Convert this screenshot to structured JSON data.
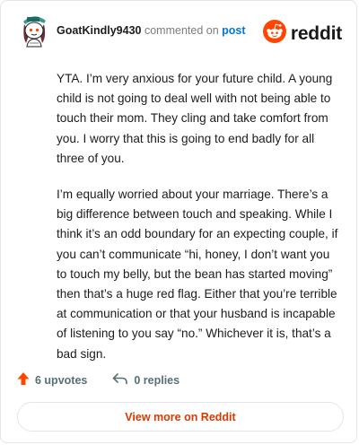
{
  "comment": {
    "author": "GoatKindly9430",
    "action_text": "commented on",
    "post_link_label": "post",
    "avatar_icon": "snoo-avatar-icon",
    "paragraphs": [
      "YTA. I’m very anxious for your future child. A young child is not going to deal well with not being able to touch their mom. They cling and take comfort from you. I worry that this is going to end badly for all three of you.",
      "I’m equally worried about your marriage. There’s a big difference between touch and speaking. While I think it’s an odd boundary for an expecting couple, if you can’t communicate “hi, honey, I don’t want you to touch my belly, but the bean has started moving” then that’s a huge red flag. Either that you’re terrible at communication or that your husband is incapable of listening to you say “no.” Whichever it is, that’s a bad sign."
    ]
  },
  "brand": {
    "name": "reddit",
    "logo_icon": "reddit-snoo-icon",
    "color": "#ff4500"
  },
  "actions": {
    "upvotes_label": "6 upvotes",
    "upvote_icon": "upvote-arrow-icon",
    "upvote_color": "#ff4500",
    "replies_label": "0 replies",
    "reply_icon": "reply-arrow-icon"
  },
  "footer": {
    "view_more_label": "View more on Reddit",
    "view_more_color": "#d93a00"
  }
}
